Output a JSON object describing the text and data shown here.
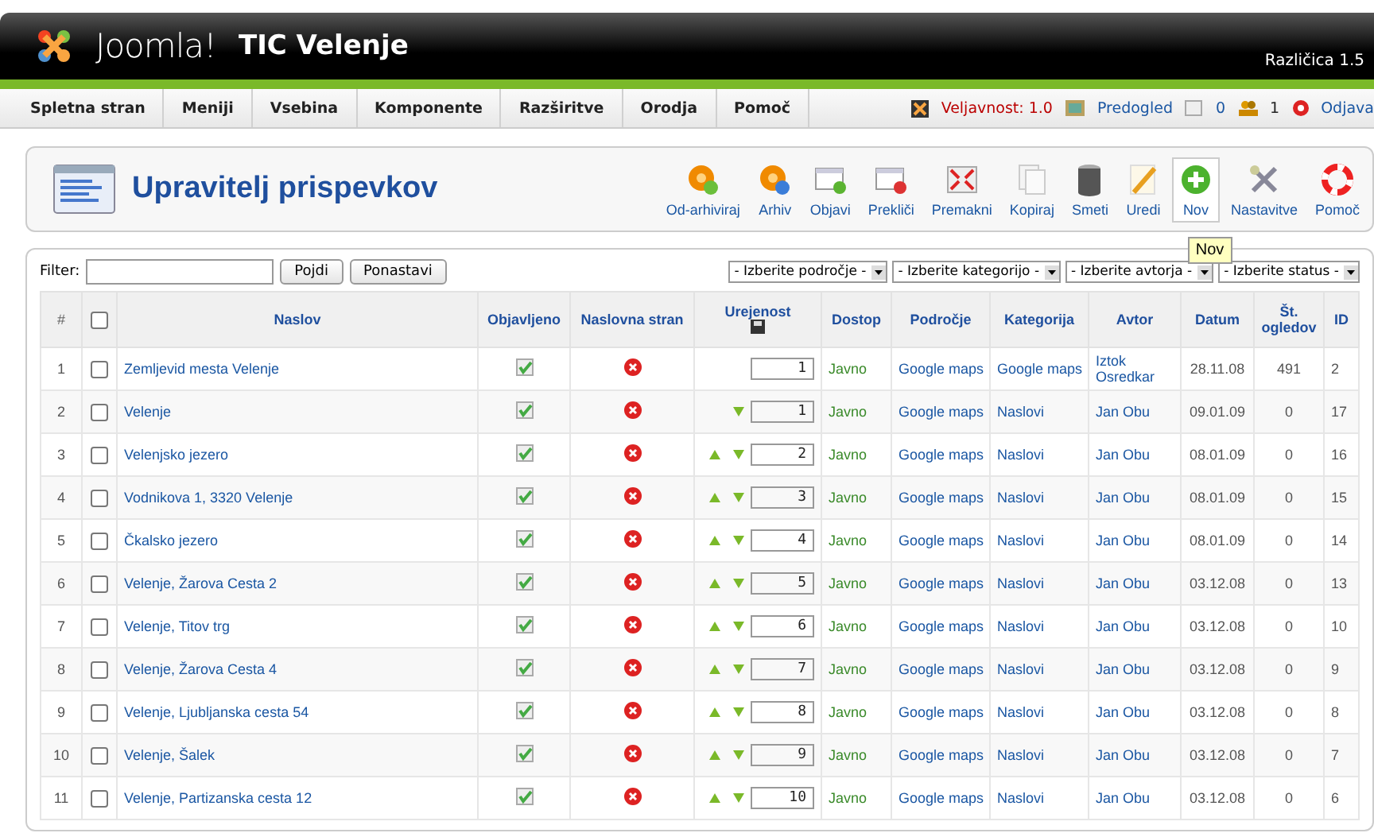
{
  "header": {
    "logo": "Joomla!",
    "site_title": "TIC Velenje",
    "version": "Različica 1.5"
  },
  "menu": [
    {
      "label": "Spletna stran"
    },
    {
      "label": "Meniji"
    },
    {
      "label": "Vsebina"
    },
    {
      "label": "Komponente"
    },
    {
      "label": "Razširitve"
    },
    {
      "label": "Orodja"
    },
    {
      "label": "Pomoč"
    }
  ],
  "status": {
    "validity": "Veljavnost: 1.0",
    "preview": "Predogled",
    "messages": "0",
    "users": "1",
    "logout": "Odjava"
  },
  "page_title": "Upravitelj prispevkov",
  "toolbar": [
    {
      "kind": "unarchive",
      "label": "Od-arhiviraj",
      "hovered": false
    },
    {
      "kind": "archive",
      "label": "Arhiv",
      "hovered": false
    },
    {
      "kind": "publish",
      "label": "Objavi",
      "hovered": false
    },
    {
      "kind": "unpublish",
      "label": "Prekliči",
      "hovered": false
    },
    {
      "kind": "move",
      "label": "Premakni",
      "hovered": false
    },
    {
      "kind": "copy",
      "label": "Kopiraj",
      "hovered": false
    },
    {
      "kind": "trash",
      "label": "Smeti",
      "hovered": false
    },
    {
      "kind": "edit",
      "label": "Uredi",
      "hovered": false
    },
    {
      "kind": "new",
      "label": "Nov",
      "hovered": true
    },
    {
      "kind": "settings",
      "label": "Nastavitve",
      "hovered": false
    },
    {
      "kind": "help",
      "label": "Pomoč",
      "hovered": false
    }
  ],
  "tooltip": "Nov",
  "filter": {
    "label": "Filter:",
    "go": "Pojdi",
    "reset": "Ponastavi",
    "selects": [
      "- Izberite področje -",
      "- Izberite kategorijo -",
      "- Izberite avtorja -",
      "- Izberite status -"
    ]
  },
  "table": {
    "columns": [
      "#",
      "Naslov",
      "Objavljeno",
      "Naslovna stran",
      "Urejenost",
      "Dostop",
      "Področje",
      "Kategorija",
      "Avtor",
      "Datum",
      "Št. ogledov",
      "ID"
    ],
    "select_all_checked": false,
    "rows": [
      {
        "num": "1",
        "checked": false,
        "title": "Zemljevid mesta Velenje",
        "published": true,
        "frontpage": false,
        "up": false,
        "down": false,
        "order": "1",
        "access": "Javno",
        "section": "Google maps",
        "category": "Google maps",
        "author": "Iztok Osredkar",
        "date": "28.11.08",
        "hits": "491",
        "id": "2"
      },
      {
        "num": "2",
        "checked": false,
        "title": "Velenje",
        "published": true,
        "frontpage": false,
        "up": false,
        "down": true,
        "order": "1",
        "access": "Javno",
        "section": "Google maps",
        "category": "Naslovi",
        "author": "Jan Obu",
        "date": "09.01.09",
        "hits": "0",
        "id": "17"
      },
      {
        "num": "3",
        "checked": false,
        "title": "Velenjsko jezero",
        "published": true,
        "frontpage": false,
        "up": true,
        "down": true,
        "order": "2",
        "access": "Javno",
        "section": "Google maps",
        "category": "Naslovi",
        "author": "Jan Obu",
        "date": "08.01.09",
        "hits": "0",
        "id": "16"
      },
      {
        "num": "4",
        "checked": false,
        "title": "Vodnikova 1, 3320 Velenje",
        "published": true,
        "frontpage": false,
        "up": true,
        "down": true,
        "order": "3",
        "access": "Javno",
        "section": "Google maps",
        "category": "Naslovi",
        "author": "Jan Obu",
        "date": "08.01.09",
        "hits": "0",
        "id": "15"
      },
      {
        "num": "5",
        "checked": false,
        "title": "Čkalsko jezero",
        "published": true,
        "frontpage": false,
        "up": true,
        "down": true,
        "order": "4",
        "access": "Javno",
        "section": "Google maps",
        "category": "Naslovi",
        "author": "Jan Obu",
        "date": "08.01.09",
        "hits": "0",
        "id": "14"
      },
      {
        "num": "6",
        "checked": false,
        "title": "Velenje, Žarova Cesta 2",
        "published": true,
        "frontpage": false,
        "up": true,
        "down": true,
        "order": "5",
        "access": "Javno",
        "section": "Google maps",
        "category": "Naslovi",
        "author": "Jan Obu",
        "date": "03.12.08",
        "hits": "0",
        "id": "13"
      },
      {
        "num": "7",
        "checked": false,
        "title": "Velenje, Titov trg",
        "published": true,
        "frontpage": false,
        "up": true,
        "down": true,
        "order": "6",
        "access": "Javno",
        "section": "Google maps",
        "category": "Naslovi",
        "author": "Jan Obu",
        "date": "03.12.08",
        "hits": "0",
        "id": "10"
      },
      {
        "num": "8",
        "checked": false,
        "title": "Velenje, Žarova Cesta 4",
        "published": true,
        "frontpage": false,
        "up": true,
        "down": true,
        "order": "7",
        "access": "Javno",
        "section": "Google maps",
        "category": "Naslovi",
        "author": "Jan Obu",
        "date": "03.12.08",
        "hits": "0",
        "id": "9"
      },
      {
        "num": "9",
        "checked": false,
        "title": "Velenje, Ljubljanska cesta 54",
        "published": true,
        "frontpage": false,
        "up": true,
        "down": true,
        "order": "8",
        "access": "Javno",
        "section": "Google maps",
        "category": "Naslovi",
        "author": "Jan Obu",
        "date": "03.12.08",
        "hits": "0",
        "id": "8"
      },
      {
        "num": "10",
        "checked": false,
        "title": "Velenje, Šalek",
        "published": true,
        "frontpage": false,
        "up": true,
        "down": true,
        "order": "9",
        "access": "Javno",
        "section": "Google maps",
        "category": "Naslovi",
        "author": "Jan Obu",
        "date": "03.12.08",
        "hits": "0",
        "id": "7"
      },
      {
        "num": "11",
        "checked": false,
        "title": "Velenje, Partizanska cesta 12",
        "published": true,
        "frontpage": false,
        "up": true,
        "down": true,
        "order": "10",
        "access": "Javno",
        "section": "Google maps",
        "category": "Naslovi",
        "author": "Jan Obu",
        "date": "03.12.08",
        "hits": "0",
        "id": "6"
      }
    ]
  }
}
